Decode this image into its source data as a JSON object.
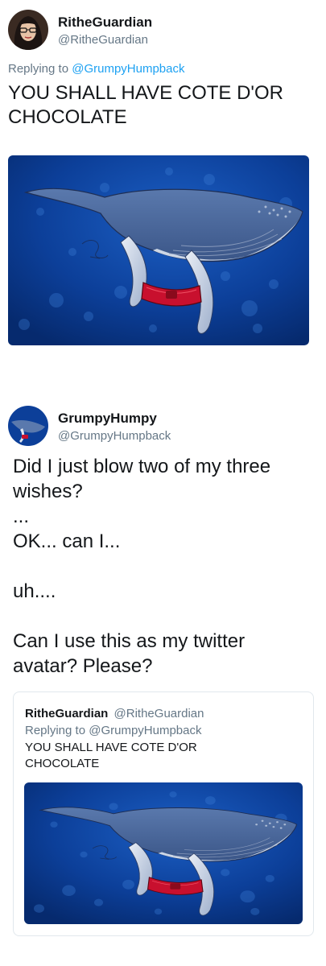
{
  "tweet1": {
    "display_name": "RitheGuardian",
    "handle": "@RitheGuardian",
    "replying_prefix": "Replying to",
    "replying_to": "@GrumpyHumpback",
    "text": "YOU SHALL HAVE COTE D'OR CHOCOLATE",
    "media_icon": "humpback-whale-drawing"
  },
  "tweet2": {
    "display_name": "GrumpyHumpy",
    "handle": "@GrumpyHumpback",
    "text_lines": [
      "Did I just blow two of my three wishes?",
      "...",
      "OK... can I...",
      "",
      "uh....",
      "",
      "Can I use this as my twitter avatar? Please?"
    ],
    "quote": {
      "display_name": "RitheGuardian",
      "handle": "@RitheGuardian",
      "replying_prefix": "Replying to",
      "replying_to": "@GrumpyHumpback",
      "text": "YOU SHALL HAVE COTE D'OR CHOCOLATE",
      "media_icon": "humpback-whale-drawing"
    }
  },
  "colors": {
    "link": "#1da1f2",
    "secondary_text": "#657786",
    "primary_text": "#14171a",
    "ocean_deep": "#0a3a8a",
    "whale_body": "#4a6698",
    "collar_red": "#c8102e"
  }
}
